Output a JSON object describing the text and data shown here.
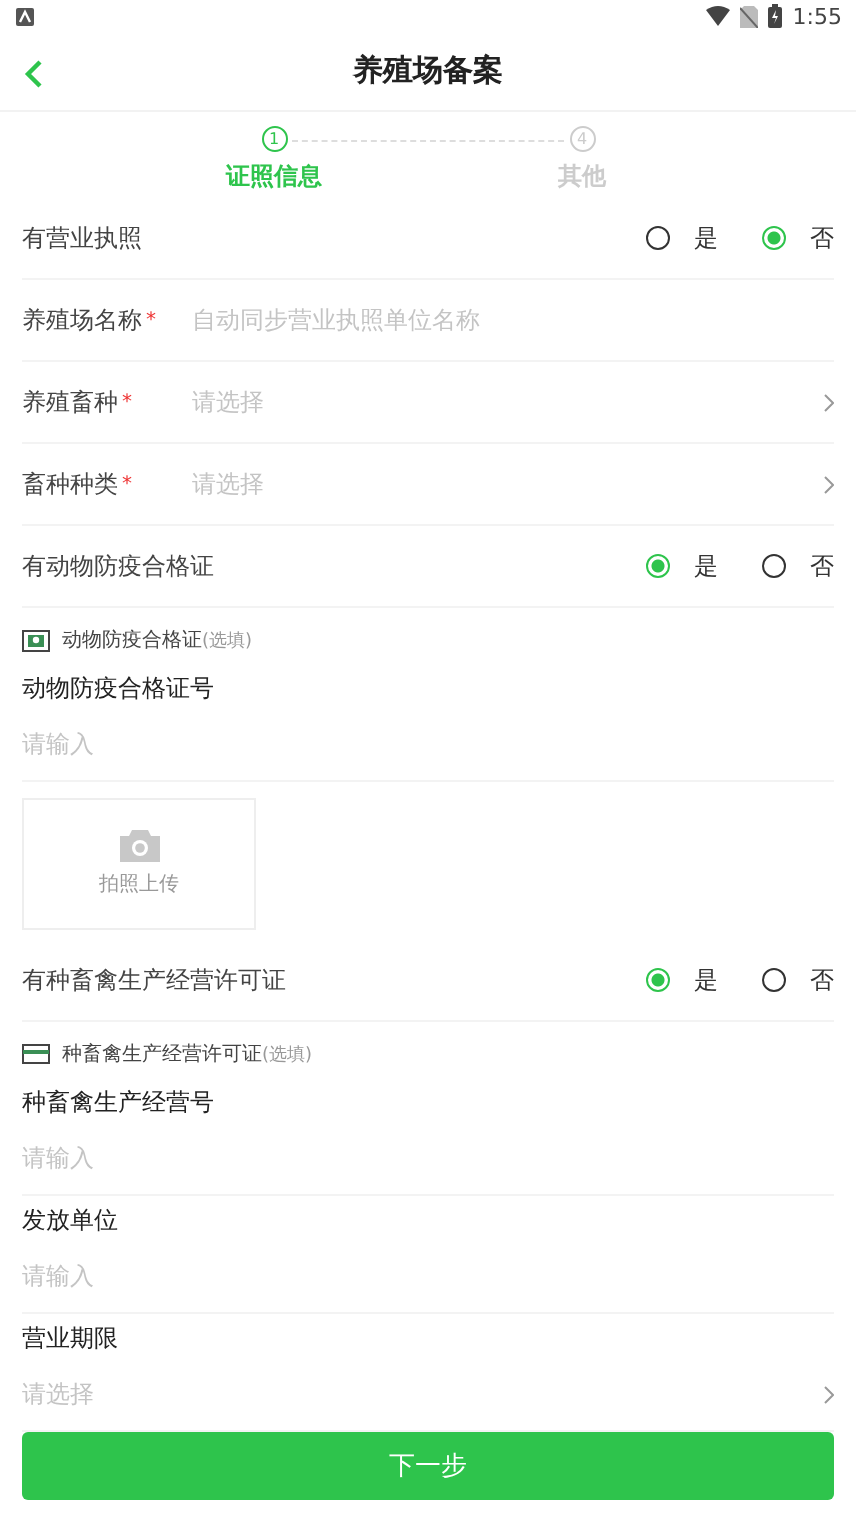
{
  "status_bar": {
    "time": "1:55"
  },
  "header": {
    "title": "养殖场备案"
  },
  "steps": [
    {
      "number": "1",
      "label": "证照信息",
      "selected": true
    },
    {
      "number": "4",
      "label": "其他",
      "selected": false
    }
  ],
  "form": [
    {
      "kind": "radio",
      "label": "有营业执照",
      "options": [
        {
          "label": "是",
          "selected": false
        },
        {
          "label": "否",
          "selected": true
        }
      ]
    },
    {
      "kind": "input",
      "label": "养殖场名称",
      "required_mark": "*",
      "placeholder": "自动同步营业执照单位名称"
    },
    {
      "kind": "select",
      "label": "养殖畜种",
      "required_mark": "*",
      "placeholder": "请选择"
    },
    {
      "kind": "select",
      "label": "畜种种类",
      "required_mark": "*",
      "placeholder": "请选择"
    },
    {
      "kind": "radio",
      "label": "有动物防疫合格证",
      "options": [
        {
          "label": "是",
          "selected": true
        },
        {
          "label": "否",
          "selected": false
        }
      ]
    },
    {
      "kind": "section",
      "title": "动物防疫合格证",
      "note": "(选填)"
    },
    {
      "kind": "stacked_input",
      "label": "动物防疫合格证号",
      "placeholder": "请输入"
    },
    {
      "kind": "upload",
      "label": "拍照上传"
    },
    {
      "kind": "radio",
      "label": "有种畜禽生产经营许可证",
      "options": [
        {
          "label": "是",
          "selected": true
        },
        {
          "label": "否",
          "selected": false
        }
      ]
    },
    {
      "kind": "section",
      "title": "种畜禽生产经营许可证",
      "note": "(选填)"
    },
    {
      "kind": "stacked_input",
      "label": "种畜禽生产经营号",
      "placeholder": "请输入"
    },
    {
      "kind": "stacked_input",
      "label": "发放单位",
      "placeholder": "请输入"
    },
    {
      "kind": "stacked_select",
      "label": "营业期限",
      "placeholder": "请选择"
    }
  ],
  "next_button": "下一步"
}
